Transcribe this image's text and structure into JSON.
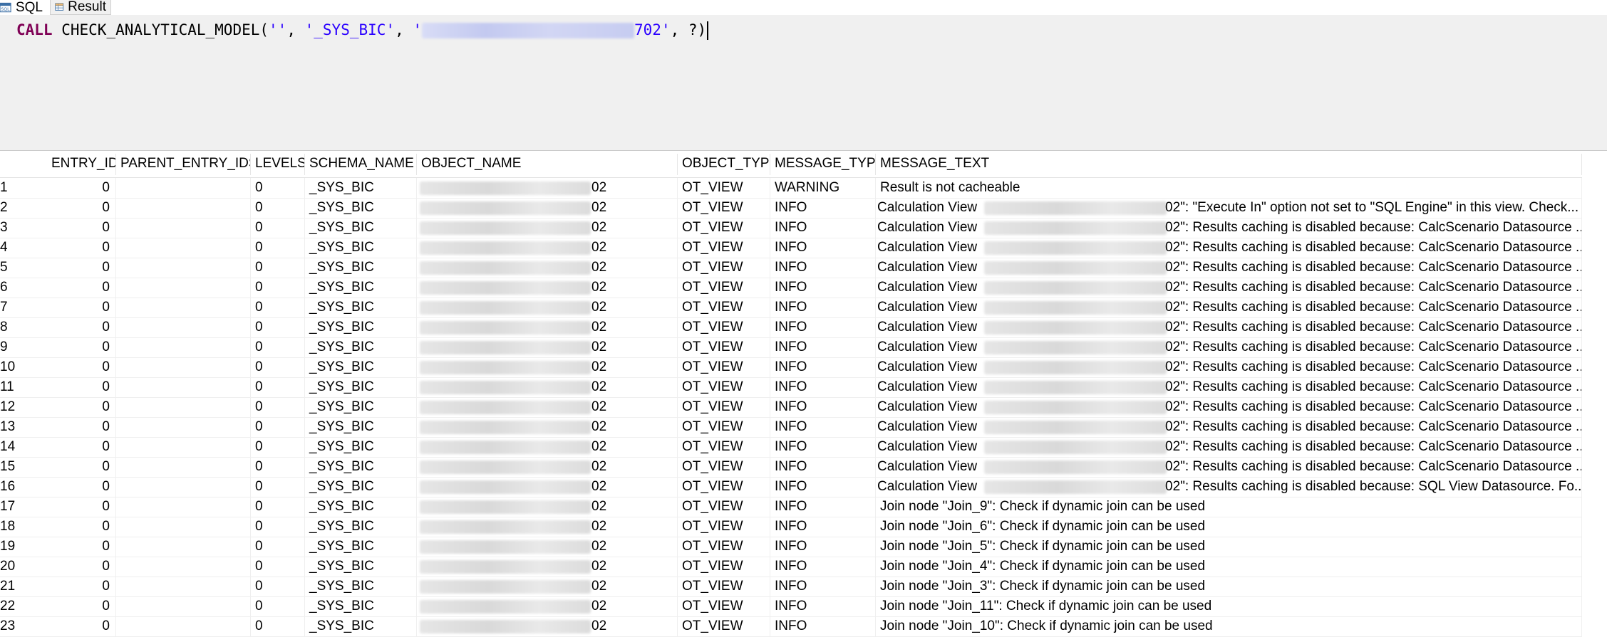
{
  "tabs": [
    {
      "label": "SQL",
      "icon": "sql-icon",
      "active": true
    },
    {
      "label": "Result",
      "icon": "table-icon",
      "active": false
    }
  ],
  "editor": {
    "keyword": "CALL",
    "procedure": "CHECK_ANALYTICAL_MODEL(",
    "arg1": "''",
    "sep1": ", ",
    "arg2": "'_SYS_BIC'",
    "sep2": ", ",
    "arg3_prefix": "'",
    "arg3_suffix": "702'",
    "tail": ", ?)"
  },
  "grid": {
    "columns": [
      "ENTRY_ID",
      "PARENT_ENTRY_IDS",
      "LEVELS",
      "SCHEMA_NAME",
      "OBJECT_NAME",
      "OBJECT_TYPE",
      "MESSAGE_TYPE",
      "MESSAGE_TEXT"
    ],
    "rows": [
      {
        "n": "1",
        "entry_id": "0",
        "levels": "0",
        "schema": "_SYS_BIC",
        "object_suffix": "02",
        "type": "OT_VIEW",
        "msg_type": "WARNING",
        "msg_prefix": "",
        "msg_text": "Result is not cacheable",
        "redacted": false
      },
      {
        "n": "2",
        "entry_id": "0",
        "levels": "0",
        "schema": "_SYS_BIC",
        "object_suffix": "02",
        "type": "OT_VIEW",
        "msg_type": "INFO",
        "msg_prefix": "Calculation View",
        "msg_text": "02\": \"Execute In\" option not set to \"SQL Engine\" in this view. Check...",
        "redacted": true
      },
      {
        "n": "3",
        "entry_id": "0",
        "levels": "0",
        "schema": "_SYS_BIC",
        "object_suffix": "02",
        "type": "OT_VIEW",
        "msg_type": "INFO",
        "msg_prefix": "Calculation View",
        "msg_text": "02\": Results caching is disabled because: CalcScenario Datasource ...",
        "redacted": true
      },
      {
        "n": "4",
        "entry_id": "0",
        "levels": "0",
        "schema": "_SYS_BIC",
        "object_suffix": "02",
        "type": "OT_VIEW",
        "msg_type": "INFO",
        "msg_prefix": "Calculation View",
        "msg_text": "02\": Results caching is disabled because: CalcScenario Datasource ...",
        "redacted": true
      },
      {
        "n": "5",
        "entry_id": "0",
        "levels": "0",
        "schema": "_SYS_BIC",
        "object_suffix": "02",
        "type": "OT_VIEW",
        "msg_type": "INFO",
        "msg_prefix": "Calculation View",
        "msg_text": "02\": Results caching is disabled because: CalcScenario Datasource ...",
        "redacted": true
      },
      {
        "n": "6",
        "entry_id": "0",
        "levels": "0",
        "schema": "_SYS_BIC",
        "object_suffix": "02",
        "type": "OT_VIEW",
        "msg_type": "INFO",
        "msg_prefix": "Calculation View",
        "msg_text": "02\": Results caching is disabled because: CalcScenario Datasource ...",
        "redacted": true
      },
      {
        "n": "7",
        "entry_id": "0",
        "levels": "0",
        "schema": "_SYS_BIC",
        "object_suffix": "02",
        "type": "OT_VIEW",
        "msg_type": "INFO",
        "msg_prefix": "Calculation View",
        "msg_text": "02\": Results caching is disabled because: CalcScenario Datasource ...",
        "redacted": true
      },
      {
        "n": "8",
        "entry_id": "0",
        "levels": "0",
        "schema": "_SYS_BIC",
        "object_suffix": "02",
        "type": "OT_VIEW",
        "msg_type": "INFO",
        "msg_prefix": "Calculation View",
        "msg_text": "02\": Results caching is disabled because: CalcScenario Datasource ...",
        "redacted": true
      },
      {
        "n": "9",
        "entry_id": "0",
        "levels": "0",
        "schema": "_SYS_BIC",
        "object_suffix": "02",
        "type": "OT_VIEW",
        "msg_type": "INFO",
        "msg_prefix": "Calculation View",
        "msg_text": "02\": Results caching is disabled because: CalcScenario Datasource ...",
        "redacted": true
      },
      {
        "n": "10",
        "entry_id": "0",
        "levels": "0",
        "schema": "_SYS_BIC",
        "object_suffix": "02",
        "type": "OT_VIEW",
        "msg_type": "INFO",
        "msg_prefix": "Calculation View",
        "msg_text": "02\": Results caching is disabled because: CalcScenario Datasource ...",
        "redacted": true
      },
      {
        "n": "11",
        "entry_id": "0",
        "levels": "0",
        "schema": "_SYS_BIC",
        "object_suffix": "02",
        "type": "OT_VIEW",
        "msg_type": "INFO",
        "msg_prefix": "Calculation View",
        "msg_text": "02\": Results caching is disabled because: CalcScenario Datasource ...",
        "redacted": true
      },
      {
        "n": "12",
        "entry_id": "0",
        "levels": "0",
        "schema": "_SYS_BIC",
        "object_suffix": "02",
        "type": "OT_VIEW",
        "msg_type": "INFO",
        "msg_prefix": "Calculation View",
        "msg_text": "02\": Results caching is disabled because: CalcScenario Datasource ...",
        "redacted": true
      },
      {
        "n": "13",
        "entry_id": "0",
        "levels": "0",
        "schema": "_SYS_BIC",
        "object_suffix": "02",
        "type": "OT_VIEW",
        "msg_type": "INFO",
        "msg_prefix": "Calculation View",
        "msg_text": "02\": Results caching is disabled because: CalcScenario Datasource ...",
        "redacted": true
      },
      {
        "n": "14",
        "entry_id": "0",
        "levels": "0",
        "schema": "_SYS_BIC",
        "object_suffix": "02",
        "type": "OT_VIEW",
        "msg_type": "INFO",
        "msg_prefix": "Calculation View",
        "msg_text": "02\": Results caching is disabled because: CalcScenario Datasource ...",
        "redacted": true
      },
      {
        "n": "15",
        "entry_id": "0",
        "levels": "0",
        "schema": "_SYS_BIC",
        "object_suffix": "02",
        "type": "OT_VIEW",
        "msg_type": "INFO",
        "msg_prefix": "Calculation View",
        "msg_text": "02\": Results caching is disabled because: CalcScenario Datasource ...",
        "redacted": true
      },
      {
        "n": "16",
        "entry_id": "0",
        "levels": "0",
        "schema": "_SYS_BIC",
        "object_suffix": "02",
        "type": "OT_VIEW",
        "msg_type": "INFO",
        "msg_prefix": "Calculation View",
        "msg_text": "02\": Results caching is disabled because: SQL View Datasource. Fo...",
        "redacted": true
      },
      {
        "n": "17",
        "entry_id": "0",
        "levels": "0",
        "schema": "_SYS_BIC",
        "object_suffix": "02",
        "type": "OT_VIEW",
        "msg_type": "INFO",
        "msg_prefix": "",
        "msg_text": "Join node \"Join_9\": Check if dynamic join can be used",
        "redacted": false
      },
      {
        "n": "18",
        "entry_id": "0",
        "levels": "0",
        "schema": "_SYS_BIC",
        "object_suffix": "02",
        "type": "OT_VIEW",
        "msg_type": "INFO",
        "msg_prefix": "",
        "msg_text": "Join node \"Join_6\": Check if dynamic join can be used",
        "redacted": false
      },
      {
        "n": "19",
        "entry_id": "0",
        "levels": "0",
        "schema": "_SYS_BIC",
        "object_suffix": "02",
        "type": "OT_VIEW",
        "msg_type": "INFO",
        "msg_prefix": "",
        "msg_text": "Join node \"Join_5\": Check if dynamic join can be used",
        "redacted": false
      },
      {
        "n": "20",
        "entry_id": "0",
        "levels": "0",
        "schema": "_SYS_BIC",
        "object_suffix": "02",
        "type": "OT_VIEW",
        "msg_type": "INFO",
        "msg_prefix": "",
        "msg_text": "Join node \"Join_4\": Check if dynamic join can be used",
        "redacted": false
      },
      {
        "n": "21",
        "entry_id": "0",
        "levels": "0",
        "schema": "_SYS_BIC",
        "object_suffix": "02",
        "type": "OT_VIEW",
        "msg_type": "INFO",
        "msg_prefix": "",
        "msg_text": "Join node \"Join_3\": Check if dynamic join can be used",
        "redacted": false
      },
      {
        "n": "22",
        "entry_id": "0",
        "levels": "0",
        "schema": "_SYS_BIC",
        "object_suffix": "02",
        "type": "OT_VIEW",
        "msg_type": "INFO",
        "msg_prefix": "",
        "msg_text": "Join node \"Join_11\": Check if dynamic join can be used",
        "redacted": false
      },
      {
        "n": "23",
        "entry_id": "0",
        "levels": "0",
        "schema": "_SYS_BIC",
        "object_suffix": "02",
        "type": "OT_VIEW",
        "msg_type": "INFO",
        "msg_prefix": "",
        "msg_text": "Join node \"Join_10\": Check if dynamic join can be used",
        "redacted": false
      }
    ]
  }
}
